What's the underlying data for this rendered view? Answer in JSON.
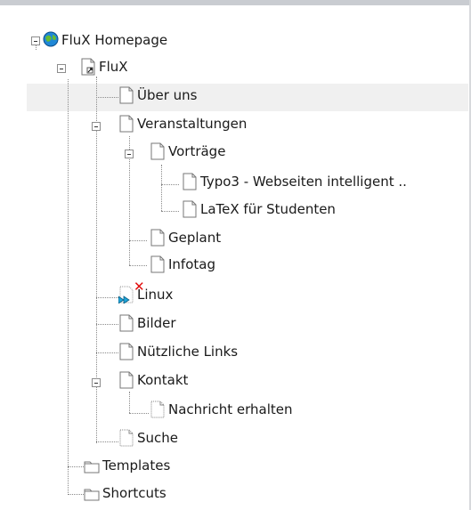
{
  "tree": {
    "root": {
      "label": "FluX Homepage",
      "icon": "globe-icon"
    },
    "flux": {
      "label": "FluX",
      "icon": "page-shortcut-icon"
    },
    "about": {
      "label": "Über uns",
      "icon": "page-icon"
    },
    "events": {
      "label": "Veranstaltungen",
      "icon": "page-icon"
    },
    "talks": {
      "label": "Vorträge",
      "icon": "page-icon"
    },
    "typo3": {
      "label": "Typo3 - Webseiten intelligent ..",
      "icon": "page-icon"
    },
    "latex": {
      "label": "LaTeX für Studenten",
      "icon": "page-icon"
    },
    "planned": {
      "label": "Geplant",
      "icon": "page-icon"
    },
    "infotag": {
      "label": "Infotag",
      "icon": "page-icon"
    },
    "linux": {
      "label": "Linux",
      "icon": "page-disabled-icon"
    },
    "images": {
      "label": "Bilder",
      "icon": "page-icon"
    },
    "links": {
      "label": "Nützliche Links",
      "icon": "page-icon"
    },
    "contact": {
      "label": "Kontakt",
      "icon": "page-icon"
    },
    "message": {
      "label": "Nachricht erhalten",
      "icon": "page-hidden-icon"
    },
    "search": {
      "label": "Suche",
      "icon": "page-hidden-icon"
    },
    "templates": {
      "label": "Templates",
      "icon": "folder-icon"
    },
    "shortcuts": {
      "label": "Shortcuts",
      "icon": "folder-icon"
    }
  },
  "colors": {
    "error": "#e20f0f",
    "hover": "#f0f0f0",
    "accent": "#1fa4d8"
  }
}
